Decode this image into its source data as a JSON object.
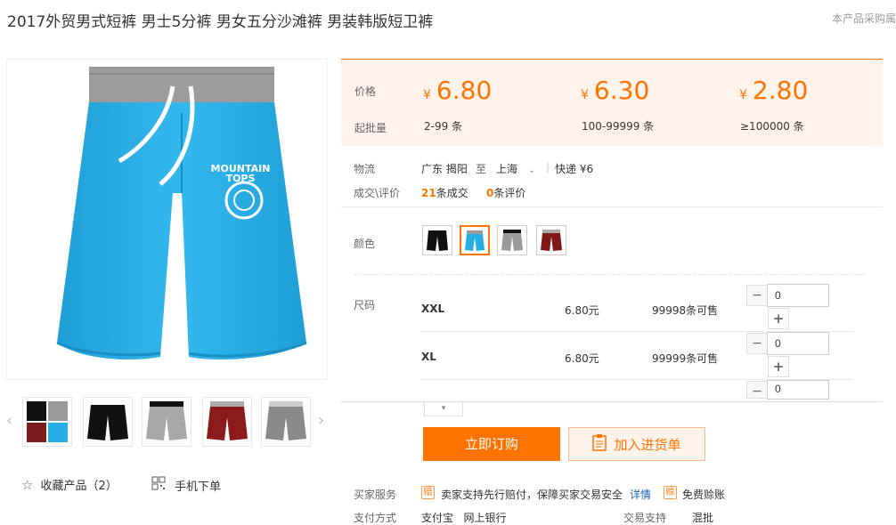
{
  "title": "2017外贸男式短裤 男士5分裤 男女五分沙滩裤 男装韩版短卫裤",
  "procurement_note": "本产品采购属",
  "colors": {
    "accent": "#ff7300",
    "price_bg": "#fff3ec",
    "link": "#1a5fb4",
    "main_product": "#27aee4"
  },
  "gallery": {
    "thumbnails": [
      "black-and-red-and-blue",
      "black",
      "gray",
      "dark-red",
      "gray-white"
    ]
  },
  "favorite": {
    "label": "收藏产品（2）"
  },
  "mobile": {
    "label": "手机下单"
  },
  "price_section": {
    "price_label": "价格",
    "moq_label": "起批量",
    "currency": "¥",
    "tiers": [
      {
        "price": "6.80",
        "range": "2-99 条"
      },
      {
        "price": "6.30",
        "range": "100-99999 条"
      },
      {
        "price": "2.80",
        "range": "≥100000 条"
      }
    ]
  },
  "logistics": {
    "label": "物流",
    "from": "广东 揭阳",
    "to_word": "至",
    "destination": "上海",
    "shipping": "快递 ¥6"
  },
  "deals": {
    "label": "成交\\评价",
    "deal_count": "21",
    "deal_text": "条成交",
    "review_count": "0",
    "review_text": "条评价"
  },
  "color_option": {
    "label": "颜色",
    "swatches": [
      "black",
      "sky-blue",
      "gray",
      "dark-red"
    ],
    "selected_index": 1
  },
  "size_option": {
    "label": "尺码",
    "rows": [
      {
        "size": "XXL",
        "price": "6.80元",
        "stock": "99998条可售",
        "qty": "0"
      },
      {
        "size": "XL",
        "price": "6.80元",
        "stock": "99999条可售",
        "qty": "0"
      },
      {
        "size": "",
        "price": "",
        "stock": "",
        "qty": "0"
      }
    ],
    "minus": "−",
    "plus": "+"
  },
  "actions": {
    "order_label": "立即订购",
    "cart_label": "加入进货单"
  },
  "service": {
    "label": "买家服务",
    "guarantee": "卖家支持先行赔付，保障买家交易安全",
    "detail_link": "详情",
    "free_credit": "免费赊账"
  },
  "payment": {
    "label": "支付方式",
    "methods": "支付宝   网上银行",
    "trade_support_label": "交易支持",
    "trade_support_value": "混批"
  }
}
